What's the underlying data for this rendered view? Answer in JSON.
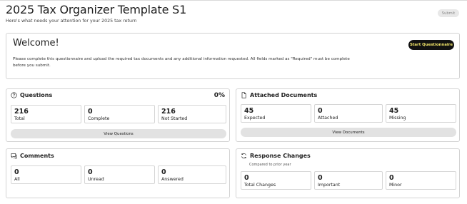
{
  "page": {
    "title": "2025 Tax Organizer Template S1",
    "subtitle": "Here's what needs your attention for your 2025 tax return",
    "submit_label": "Submit"
  },
  "welcome": {
    "title": "Welcome!",
    "text": "Please complete this questionnaire and upload the required tax documents and any additional information requested. All fields marked as \"Required\" must be complete before you submit.",
    "start_label": "Start Questionnaire"
  },
  "questions": {
    "title": "Questions",
    "percent": "0%",
    "stats": [
      {
        "value": "216",
        "label": "Total"
      },
      {
        "value": "0",
        "label": "Complete"
      },
      {
        "value": "216",
        "label": "Not Started"
      }
    ],
    "button_label": "View Questions"
  },
  "documents": {
    "title": "Attached Documents",
    "stats": [
      {
        "value": "45",
        "label": "Expected"
      },
      {
        "value": "0",
        "label": "Attached"
      },
      {
        "value": "45",
        "label": "Missing"
      }
    ],
    "button_label": "View Documents"
  },
  "comments": {
    "title": "Comments",
    "stats": [
      {
        "value": "0",
        "label": "All"
      },
      {
        "value": "0",
        "label": "Unread"
      },
      {
        "value": "0",
        "label": "Answered"
      }
    ]
  },
  "responses": {
    "title": "Response Changes",
    "subtitle": "Compared to prior year",
    "stats": [
      {
        "value": "0",
        "label": "Total Changes"
      },
      {
        "value": "0",
        "label": "Important"
      },
      {
        "value": "0",
        "label": "Minor"
      }
    ]
  },
  "icons": {
    "questions": "question-circle-icon",
    "documents": "document-icon",
    "comments": "comments-icon",
    "responses": "refresh-icon"
  }
}
